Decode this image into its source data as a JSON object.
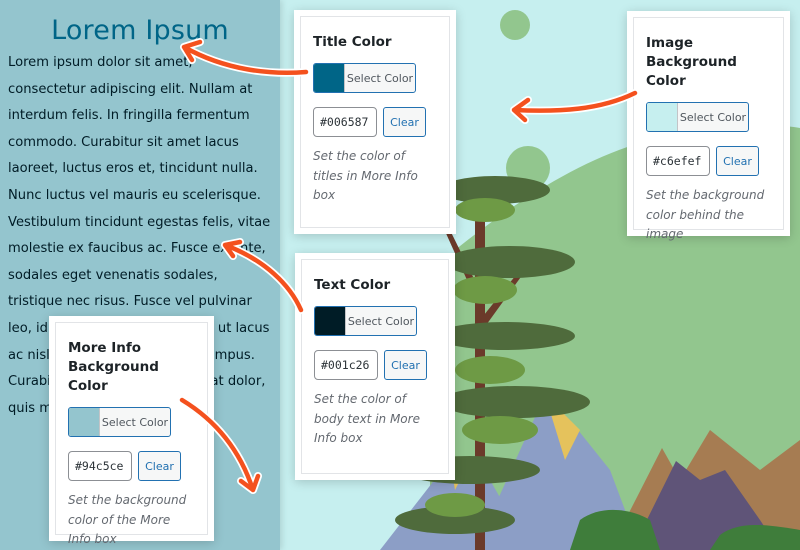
{
  "preview": {
    "title": "Lorem Ipsum",
    "body": "Lorem ipsum dolor sit amet, consectetur adipiscing elit. Nullam at interdum felis. In fringilla fermentum commodo. Curabitur sit amet lacus laoreet, luctus eros et, tincidunt nulla. Nunc luctus vel mauris eu scelerisque. Vestibulum tincidunt egestas felis, vitae molestie ex faucibus ac. Fusce ex ante, sodales eget venenatis sodales, tristique nec risus. Fusce vel pulvinar leo, id fermentum magna. Nam ut lacus ac nisl tincidunt, feugiat felis tempus. Curabitur consectetur consequat dolor, quis mattis dui mollis non."
  },
  "colors": {
    "title": "#006587",
    "text": "#001c26",
    "more_info_bg": "#94c5ce",
    "image_bg": "#c6efef",
    "arrow": "#f4511e"
  },
  "cards": {
    "title_color": {
      "heading": "Title Color",
      "select_label": "Select Color",
      "value": "#006587",
      "clear_label": "Clear",
      "description": "Set the color of titles in More Info box"
    },
    "image_bg_color": {
      "heading": "Image Background Color",
      "select_label": "Select Color",
      "value": "#c6efef",
      "clear_label": "Clear",
      "description": "Set the background color behind the image"
    },
    "text_color": {
      "heading": "Text Color",
      "select_label": "Select Color",
      "value": "#001c26",
      "clear_label": "Clear",
      "description": "Set the color of body text in More Info box"
    },
    "more_info_bg_color": {
      "heading": "More Info Background Color",
      "select_label": "Select Color",
      "value": "#94c5ce",
      "clear_label": "Clear",
      "description": "Set the background color of the More Info box"
    }
  }
}
